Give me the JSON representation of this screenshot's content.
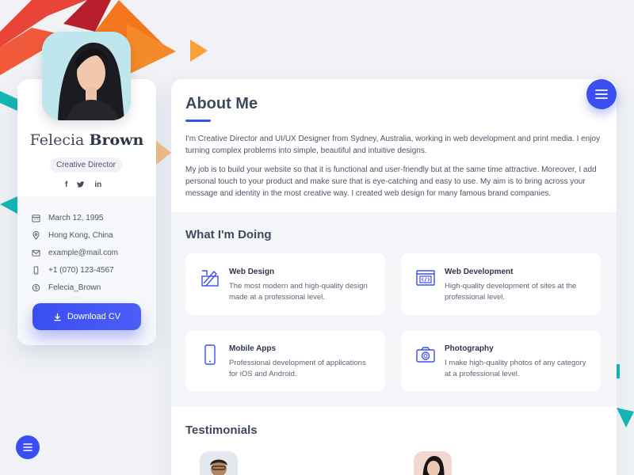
{
  "profile": {
    "first_name": "Felecia",
    "last_name": "Brown",
    "role": "Creative Director",
    "socials": [
      "f",
      "t",
      "in"
    ],
    "info": [
      {
        "icon": "calendar-icon",
        "text": "March 12, 1995"
      },
      {
        "icon": "location-icon",
        "text": "Hong Kong, China"
      },
      {
        "icon": "mail-icon",
        "text": "example@mail.com"
      },
      {
        "icon": "phone-icon",
        "text": "+1 (070) 123-4567"
      },
      {
        "icon": "skype-icon",
        "text": "Felecia_Brown"
      }
    ],
    "download_label": "Download CV"
  },
  "about": {
    "title": "About Me",
    "paragraphs": [
      "I'm Creative Director and UI/UX Designer from Sydney, Australia, working in web development and print media. I enjoy turning complex problems into simple, beautiful and intuitive designs.",
      "My job is to build your website so that it is functional and user-friendly but at the same time attractive. Moreover, I add personal touch to your product and make sure that is eye-catching and easy to use. My aim is to bring across your message and identity in the most creative way. I created web design for many famous brand companies."
    ]
  },
  "doing": {
    "title": "What I'm Doing",
    "services": [
      {
        "icon": "design-icon",
        "title": "Web Design",
        "desc": "The most modern and high-quality design made at a professional level."
      },
      {
        "icon": "code-icon",
        "title": "Web Development",
        "desc": "High-quality development of sites at the professional level."
      },
      {
        "icon": "mobile-icon",
        "title": "Mobile Apps",
        "desc": "Professional development of applications for iOS and Android."
      },
      {
        "icon": "camera-icon",
        "title": "Photography",
        "desc": "I make high-quality photos of any category at a professional level."
      }
    ]
  },
  "testimonials": {
    "title": "Testimonials"
  },
  "colors": {
    "accent": "#3b4ef0",
    "heading": "#3d4a5c",
    "background": "#f0f2f5"
  }
}
